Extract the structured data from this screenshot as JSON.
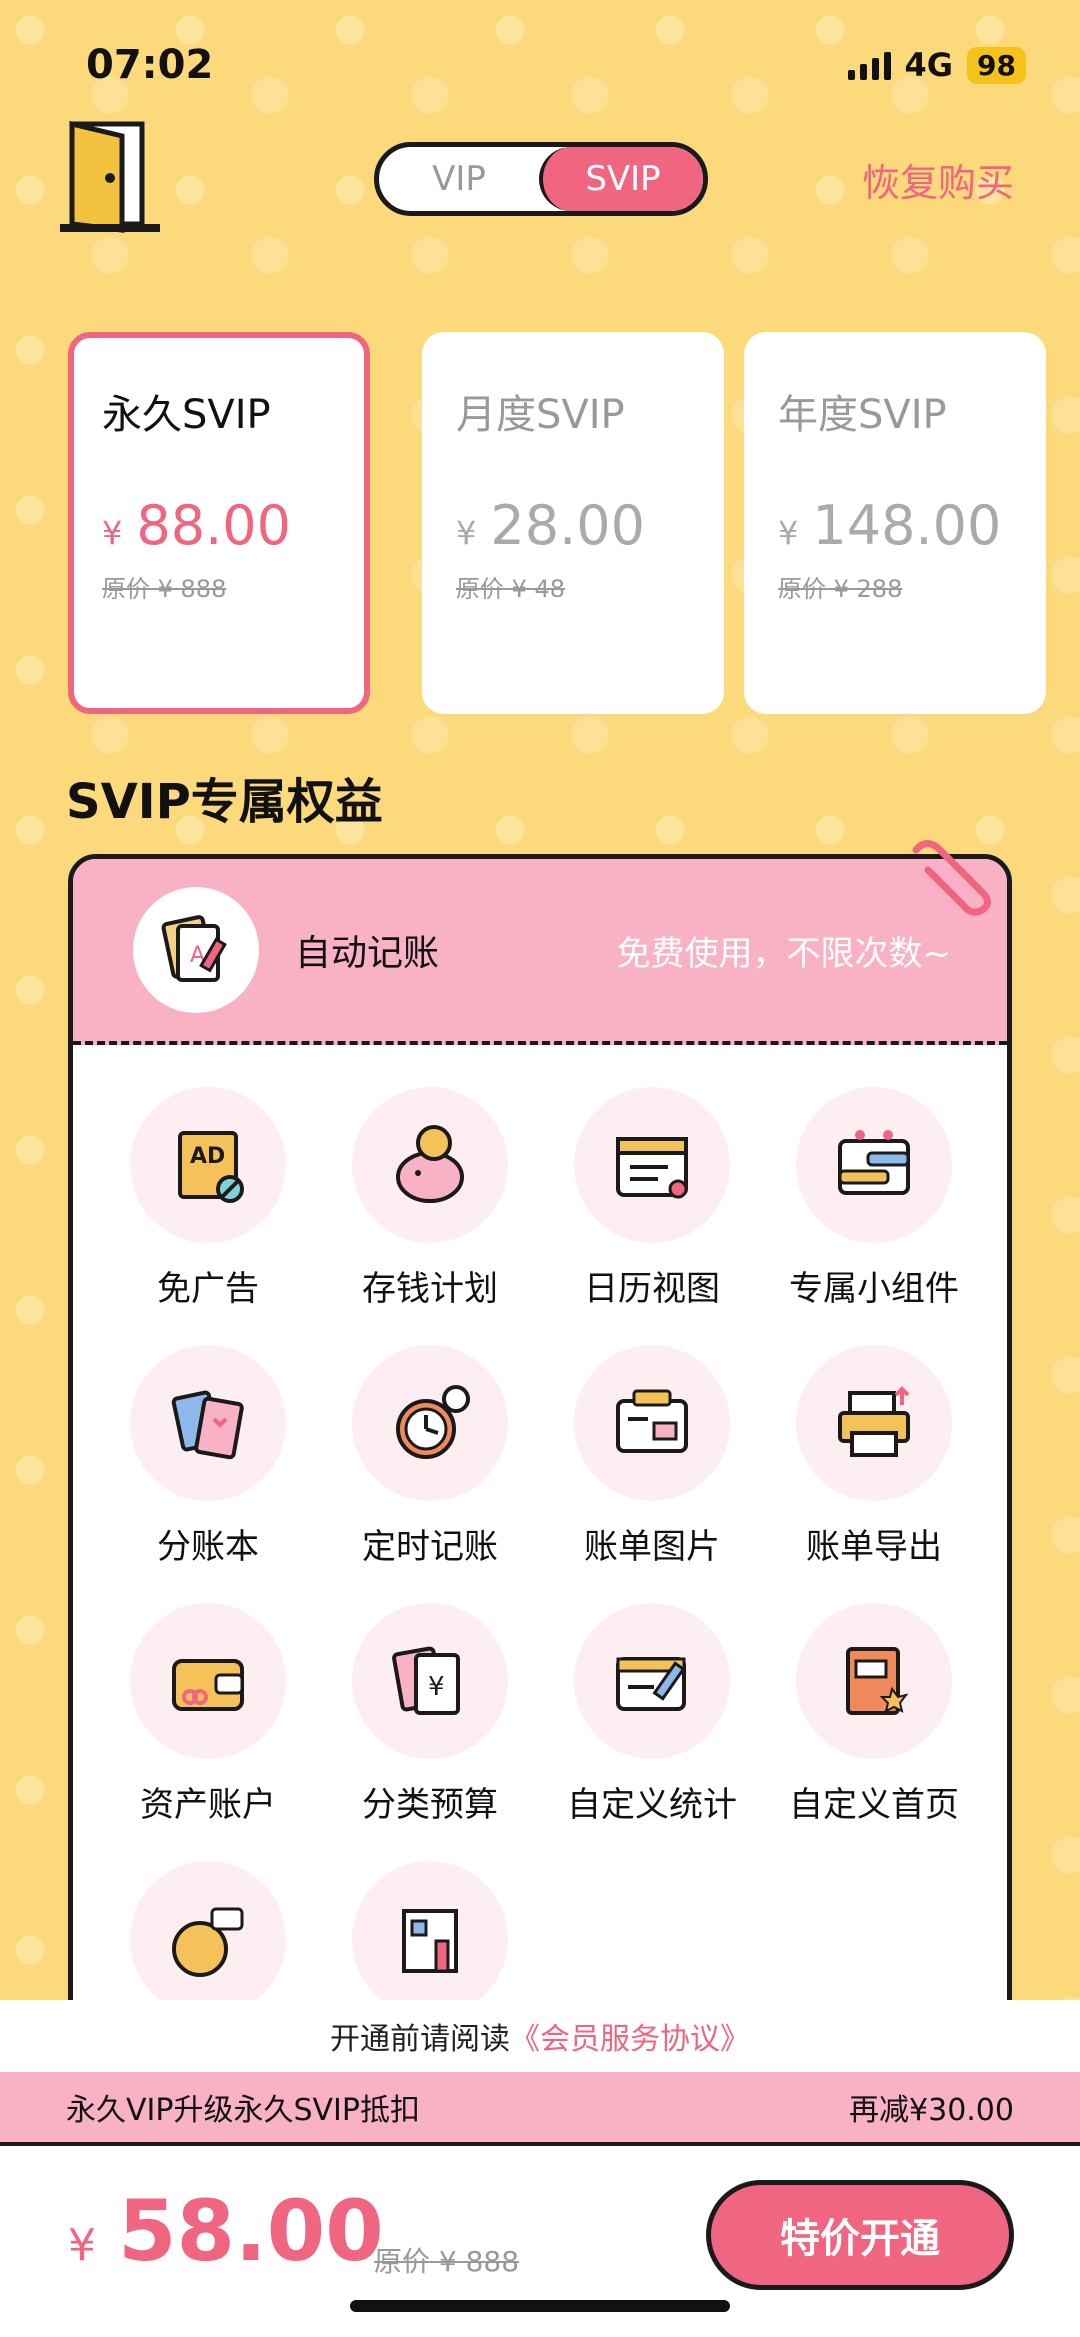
{
  "status": {
    "time": "07:02",
    "network": "4G",
    "battery": "98"
  },
  "header": {
    "tabs": [
      "VIP",
      "SVIP"
    ],
    "active_tab": "SVIP",
    "restore": "恢复购买"
  },
  "plans": [
    {
      "name": "永久SVIP",
      "currency": "¥",
      "price": "88.00",
      "original": "原价 ¥ 888",
      "selected": true
    },
    {
      "name": "月度SVIP",
      "currency": "¥",
      "price": "28.00",
      "original": "原价 ¥ 48",
      "selected": false
    },
    {
      "name": "年度SVIP",
      "currency": "¥",
      "price": "148.00",
      "original": "原价 ¥ 288",
      "selected": false
    }
  ],
  "section_title": "SVIP专属权益",
  "featured": {
    "label": "自动记账",
    "desc": "免费使用，不限次数~"
  },
  "benefits": [
    {
      "label": "免广告",
      "icon": "ad-block-icon"
    },
    {
      "label": "存钱计划",
      "icon": "piggy-bank-icon"
    },
    {
      "label": "日历视图",
      "icon": "calendar-icon"
    },
    {
      "label": "专属小组件",
      "icon": "widget-icon"
    },
    {
      "label": "分账本",
      "icon": "ledger-books-icon"
    },
    {
      "label": "定时记账",
      "icon": "alarm-clock-icon"
    },
    {
      "label": "账单图片",
      "icon": "bill-image-icon"
    },
    {
      "label": "账单导出",
      "icon": "printer-export-icon"
    },
    {
      "label": "资产账户",
      "icon": "wallet-icon"
    },
    {
      "label": "分类预算",
      "icon": "budget-document-icon"
    },
    {
      "label": "自定义统计",
      "icon": "custom-stats-icon"
    },
    {
      "label": "自定义首页",
      "icon": "notebook-icon"
    },
    {
      "label": "",
      "icon": "bear-message-icon"
    },
    {
      "label": "",
      "icon": "building-icon"
    }
  ],
  "agreement": {
    "prefix": "开通前请阅读",
    "link": "《会员服务协议》"
  },
  "upgrade": {
    "label": "永久VIP升级永久SVIP抵扣",
    "discount": "再减¥30.00"
  },
  "footer": {
    "currency": "¥",
    "price": "58.00",
    "original": "原价 ¥ 888",
    "button": "特价开通"
  },
  "colors": {
    "accent": "#f0657f",
    "background": "#fcd97a",
    "pink_light": "#f9b1c5"
  }
}
